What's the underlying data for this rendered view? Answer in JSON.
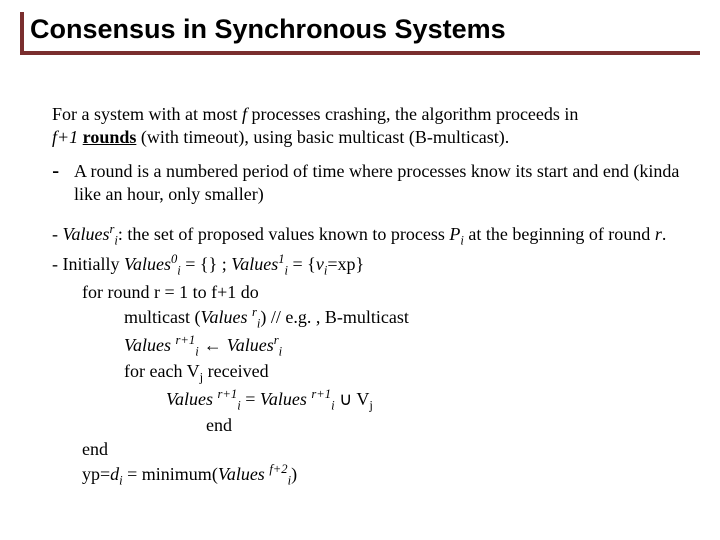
{
  "title": "Consensus in Synchronous Systems",
  "intro": {
    "pre": "For a system with at most ",
    "f": "f",
    "mid": " processes crashing, the algorithm proceeds in ",
    "fplus1": "f+1",
    "space": " ",
    "rounds": "rounds",
    "post": " (with timeout), using basic multicast (B-multicast)."
  },
  "bullet": {
    "dash": "-",
    "text": "A round is a numbered period of time where processes know its start and end (kinda like an hour, only smaller)"
  },
  "algo": {
    "def1": {
      "dash": "- ",
      "values": "Values",
      "sup_r": "r",
      "sub_i": "i",
      "colon": ": the set of proposed values known to process ",
      "P": "P",
      "at": " at the beginning of round ",
      "r": "r",
      "dot": "."
    },
    "def2": {
      "dash": "- Initially ",
      "values1": "Values",
      "sup0": "0",
      "sub_i": "i",
      "eq1": " = {} ; ",
      "values2": "Values",
      "sup1": "1",
      "eq2": " = {",
      "v": "v",
      "eq3": "=xp}"
    },
    "for": {
      "text": "for round r = 1 to f+1 do"
    },
    "multicast": {
      "pre": "multicast (",
      "values": "Values ",
      "sup_r": "r",
      "sub_i": "i",
      "post": ") // e.g. , B-multicast"
    },
    "assign1": {
      "values1": "Values ",
      "sup_r1": "r+1",
      "sub_i": "i",
      "arrow": " ← ",
      "values2": "Values",
      "sup_r2": "r"
    },
    "foreach": {
      "pre": "for each V",
      "sub_j": "j",
      "post": " received"
    },
    "assign2": {
      "values1": "Values ",
      "sup_r1": "r+1",
      "sub_i": "i",
      "eq": " = ",
      "values2": "Values ",
      "union": " ∪ V",
      "sub_j": "j"
    },
    "end1": "end",
    "end2": "end",
    "yp": {
      "pre": "yp=",
      "d": "d",
      "sub_i": "i",
      "eq": " = minimum(",
      "values": "Values ",
      "sup": "f+2",
      "post": ")"
    }
  }
}
